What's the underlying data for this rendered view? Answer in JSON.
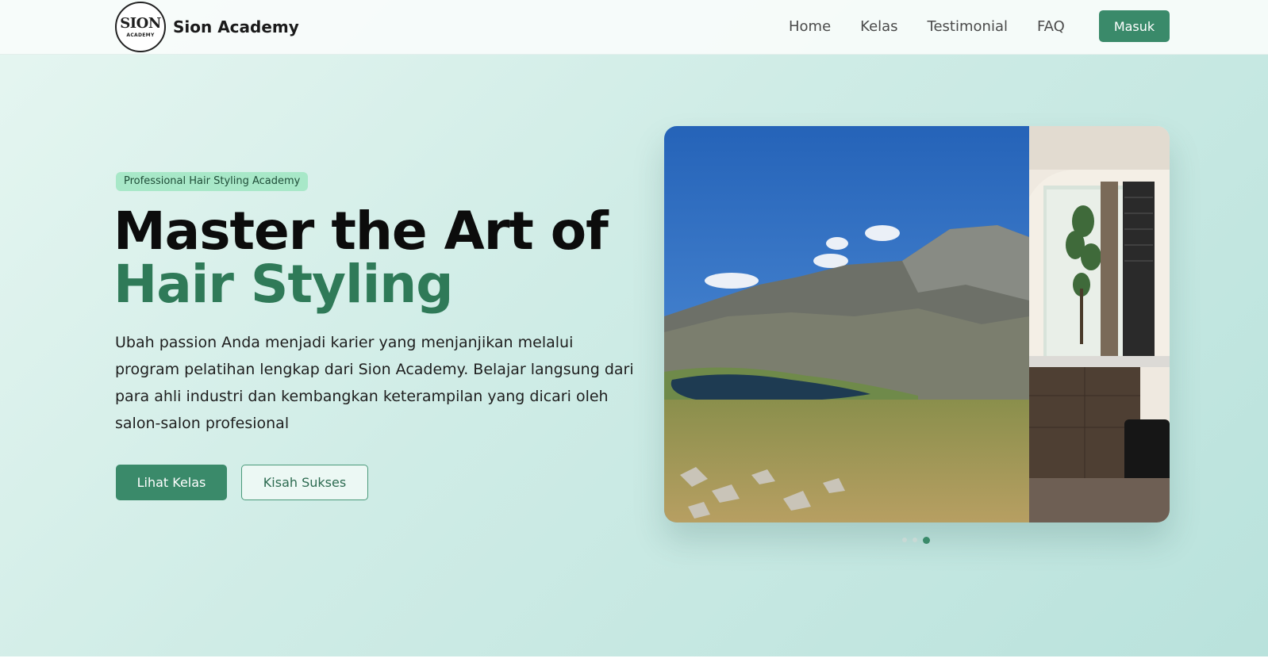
{
  "brand": {
    "name": "Sion Academy",
    "logo_mark": "SION",
    "logo_subtext": "ACADEMY"
  },
  "nav": {
    "links": [
      "Home",
      "Kelas",
      "Testimonial",
      "FAQ"
    ],
    "login_label": "Masuk"
  },
  "hero": {
    "badge": "Professional Hair Styling Academy",
    "headline_line1": "Master the Art of",
    "headline_line2": "Hair Styling",
    "description": "Ubah passion Anda menjadi karier yang menjanjikan melalui program pelatihan lengkap dari Sion Academy. Belajar langsung dari para ahli industri dan kembangkan keterampilan yang dicari oleh salon-salon profesional",
    "primary_button": "Lihat Kelas",
    "secondary_button": "Kisah Sukses"
  },
  "carousel": {
    "slide_count": 3,
    "active_index": 2
  },
  "colors": {
    "accent": "#3a8a6a",
    "headline_accent": "#2f7a58",
    "badge_bg": "#a8e8c8"
  }
}
